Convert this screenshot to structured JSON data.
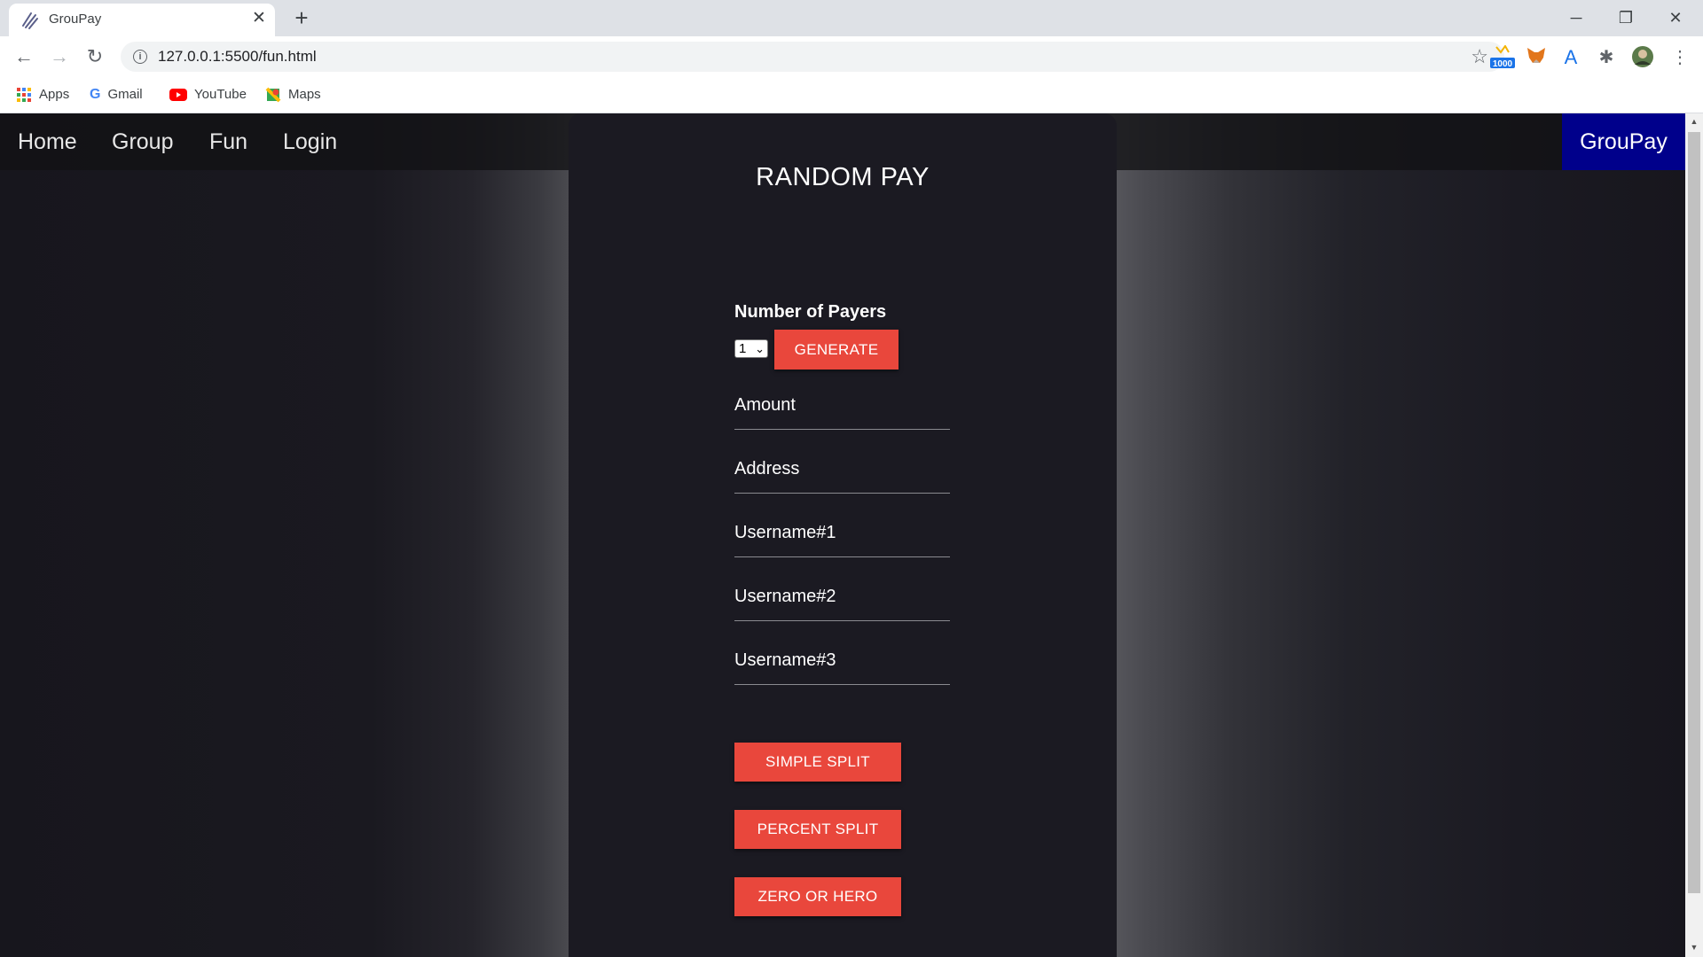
{
  "browser": {
    "tab_title": "GrouPay",
    "tab_close": "✕",
    "new_tab": "+",
    "url": "127.0.0.1:5500/fun.html",
    "extension_badge": "1000",
    "window_controls": {
      "minimize": "─",
      "restore": "❐",
      "close": "✕"
    },
    "bookmarks": [
      {
        "label": "Apps",
        "icon": "apps-grid-icon"
      },
      {
        "label": "Gmail",
        "icon": "google-icon"
      },
      {
        "label": "YouTube",
        "icon": "youtube-icon"
      },
      {
        "label": "Maps",
        "icon": "maps-icon"
      }
    ]
  },
  "nav": {
    "links": [
      "Home",
      "Group",
      "Fun",
      "Login"
    ],
    "brand": "GrouPay",
    "brand_color": "#00008b"
  },
  "main": {
    "title": "RANDOM PAY",
    "payers_label": "Number of Payers",
    "payers_selected": "1",
    "generate_button": "GENERATE",
    "fields": [
      "Amount",
      "Address",
      "Username#1",
      "Username#2",
      "Username#3"
    ],
    "actions": [
      "SIMPLE SPLIT",
      "PERCENT SPLIT",
      "ZERO OR HERO"
    ],
    "accent_color": "#e9473c"
  }
}
